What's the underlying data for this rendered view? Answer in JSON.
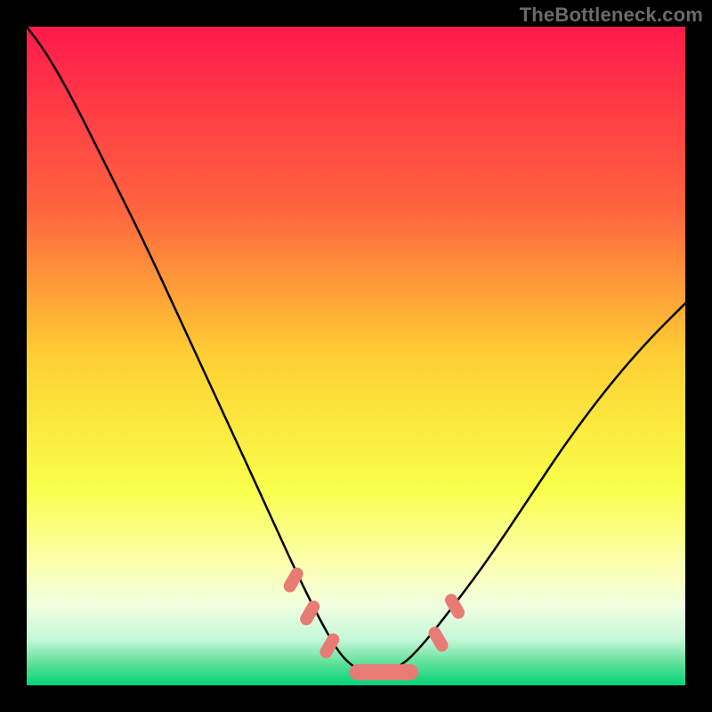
{
  "watermark": "TheBottleneck.com",
  "chart_data": {
    "type": "line",
    "title": "",
    "xlabel": "",
    "ylabel": "",
    "xlim": [
      0,
      100
    ],
    "ylim": [
      0,
      100
    ],
    "grid": false,
    "legend": false,
    "background_gradient": {
      "stops": [
        {
          "pos": 0.0,
          "color": "#ff1a4b"
        },
        {
          "pos": 0.28,
          "color": "#ff653e"
        },
        {
          "pos": 0.5,
          "color": "#ffcf33"
        },
        {
          "pos": 0.7,
          "color": "#f9ff4a"
        },
        {
          "pos": 0.82,
          "color": "#fcffb3"
        },
        {
          "pos": 0.88,
          "color": "#efffe0"
        },
        {
          "pos": 0.93,
          "color": "#c6f7d9"
        },
        {
          "pos": 0.965,
          "color": "#63e29a"
        },
        {
          "pos": 1.0,
          "color": "#00d37a"
        }
      ]
    },
    "series": [
      {
        "name": "bottleneck-curve",
        "color": "#000000",
        "x": [
          0,
          3,
          7,
          12,
          18,
          24,
          30,
          36,
          41,
          45,
          48,
          51,
          54,
          57,
          60,
          64,
          70,
          76,
          82,
          88,
          94,
          100
        ],
        "y": [
          100,
          96,
          89,
          79,
          67,
          54,
          41,
          28,
          17,
          9,
          4,
          2,
          2,
          3,
          6,
          11,
          19,
          28,
          37,
          45,
          52,
          58
        ]
      },
      {
        "name": "highlight-left-1",
        "type": "marker",
        "color": "#e87b74",
        "x": [
          40.5
        ],
        "y": [
          16
        ]
      },
      {
        "name": "highlight-left-2",
        "type": "marker",
        "color": "#e87b74",
        "x": [
          43
        ],
        "y": [
          11
        ]
      },
      {
        "name": "highlight-left-3",
        "type": "marker",
        "color": "#e87b74",
        "x": [
          46
        ],
        "y": [
          6
        ]
      },
      {
        "name": "flat-pill",
        "type": "pill",
        "color": "#e87b74",
        "x_start": 49,
        "x_end": 59.5,
        "y": 2
      },
      {
        "name": "highlight-right-1",
        "type": "marker",
        "color": "#e87b74",
        "x": [
          62.5
        ],
        "y": [
          7
        ]
      },
      {
        "name": "highlight-right-2",
        "type": "marker",
        "color": "#e87b74",
        "x": [
          65
        ],
        "y": [
          12
        ]
      }
    ]
  }
}
